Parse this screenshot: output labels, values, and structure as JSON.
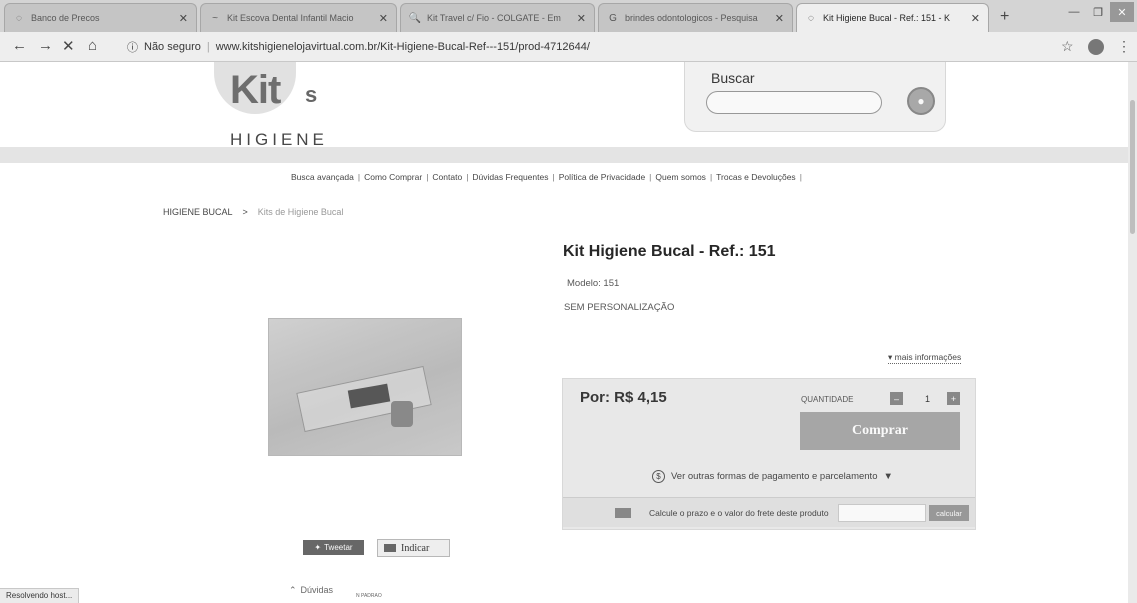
{
  "browser": {
    "tabs": [
      {
        "title": "Banco de Precos",
        "active": false
      },
      {
        "title": "Kit Escova Dental Infantil Macio",
        "active": false
      },
      {
        "title": "Kit Travel c/ Fio - COLGATE - Em",
        "active": false
      },
      {
        "title": "brindes odontologicos - Pesquisa",
        "active": false
      },
      {
        "title": "Kit Higiene Bucal - Ref.: 151 - K",
        "active": true
      }
    ],
    "security": "Não seguro",
    "url": "www.kitshigienelojavirtual.com.br/Kit-Higiene-Bucal-Ref---151/prod-4712644/"
  },
  "header": {
    "logo_main": "Kit",
    "logo_suffix": "s",
    "logo_sub": "HIGIENE",
    "search_label": "Buscar",
    "search_placeholder": ""
  },
  "nav": [
    "Busca avançada",
    "Como Comprar",
    "Contato",
    "Dúvidas Frequentes",
    "Política de Privacidade",
    "Quem somos",
    "Trocas e Devoluções"
  ],
  "breadcrumb": {
    "parent": "HIGIENE BUCAL",
    "separator": ">",
    "current": "Kits de Higiene Bucal"
  },
  "product": {
    "title": "Kit Higiene Bucal - Ref.: 151",
    "modelo": "Modelo: 151",
    "personalizacao": "SEM PERSONALIZAÇÃO",
    "mais_info": "▾ mais informações",
    "price": "Por: R$ 4,15",
    "qty_label": "QUANTIDADE",
    "qty": "1",
    "buy_label": "Comprar",
    "payment_link": "Ver outras formas de pagamento e parcelamento",
    "frete_text": "Calcule o prazo e o valor do frete deste produto",
    "calc_label": "calcular"
  },
  "social": {
    "tweet": "Tweetar",
    "indicar": "Indicar"
  },
  "footer_partial": "Dúvidas",
  "status_bar": "Resolvendo host...",
  "status_small": "N PADRAO"
}
